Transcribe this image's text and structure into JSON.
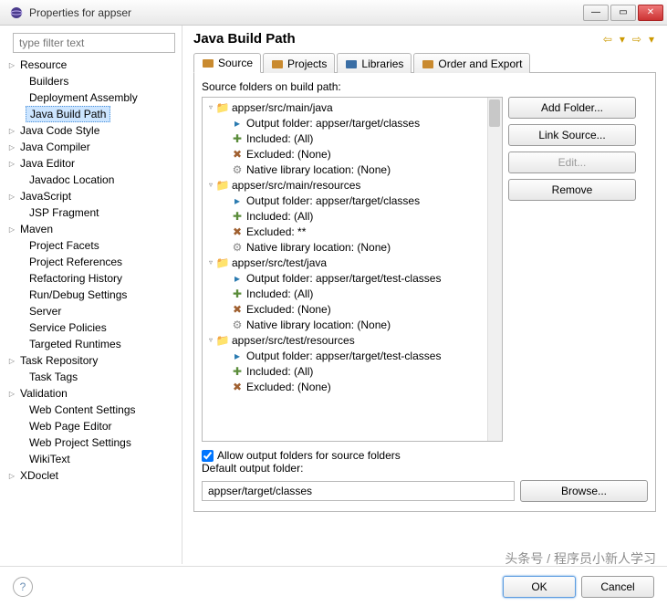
{
  "window": {
    "title": "Properties for appser"
  },
  "sidebar": {
    "filter_placeholder": "type filter text",
    "items": [
      {
        "label": "Resource",
        "expand": true,
        "indent": false
      },
      {
        "label": "Builders",
        "expand": false,
        "indent": true
      },
      {
        "label": "Deployment Assembly",
        "expand": false,
        "indent": true
      },
      {
        "label": "Java Build Path",
        "expand": false,
        "indent": true,
        "selected": true
      },
      {
        "label": "Java Code Style",
        "expand": true,
        "indent": false
      },
      {
        "label": "Java Compiler",
        "expand": true,
        "indent": false
      },
      {
        "label": "Java Editor",
        "expand": true,
        "indent": false
      },
      {
        "label": "Javadoc Location",
        "expand": false,
        "indent": true
      },
      {
        "label": "JavaScript",
        "expand": true,
        "indent": false
      },
      {
        "label": "JSP Fragment",
        "expand": false,
        "indent": true
      },
      {
        "label": "Maven",
        "expand": true,
        "indent": false
      },
      {
        "label": "Project Facets",
        "expand": false,
        "indent": true
      },
      {
        "label": "Project References",
        "expand": false,
        "indent": true
      },
      {
        "label": "Refactoring History",
        "expand": false,
        "indent": true
      },
      {
        "label": "Run/Debug Settings",
        "expand": false,
        "indent": true
      },
      {
        "label": "Server",
        "expand": false,
        "indent": true
      },
      {
        "label": "Service Policies",
        "expand": false,
        "indent": true
      },
      {
        "label": "Targeted Runtimes",
        "expand": false,
        "indent": true
      },
      {
        "label": "Task Repository",
        "expand": true,
        "indent": false
      },
      {
        "label": "Task Tags",
        "expand": false,
        "indent": true
      },
      {
        "label": "Validation",
        "expand": true,
        "indent": false
      },
      {
        "label": "Web Content Settings",
        "expand": false,
        "indent": true
      },
      {
        "label": "Web Page Editor",
        "expand": false,
        "indent": true
      },
      {
        "label": "Web Project Settings",
        "expand": false,
        "indent": true
      },
      {
        "label": "WikiText",
        "expand": false,
        "indent": true
      },
      {
        "label": "XDoclet",
        "expand": true,
        "indent": false
      }
    ]
  },
  "header": {
    "title": "Java Build Path"
  },
  "tabs": [
    {
      "label": "Source",
      "active": true
    },
    {
      "label": "Projects",
      "active": false
    },
    {
      "label": "Libraries",
      "active": false
    },
    {
      "label": "Order and Export",
      "active": false
    }
  ],
  "source": {
    "label": "Source folders on build path:",
    "tree": [
      {
        "indent": 0,
        "twist": "▿",
        "ico": "folder",
        "text": "appser/src/main/java"
      },
      {
        "indent": 1,
        "twist": "",
        "ico": "out",
        "text": "Output folder: appser/target/classes"
      },
      {
        "indent": 1,
        "twist": "",
        "ico": "inc",
        "text": "Included: (All)"
      },
      {
        "indent": 1,
        "twist": "",
        "ico": "exc",
        "text": "Excluded: (None)"
      },
      {
        "indent": 1,
        "twist": "",
        "ico": "nat",
        "text": "Native library location: (None)"
      },
      {
        "indent": 0,
        "twist": "▿",
        "ico": "folder",
        "text": "appser/src/main/resources"
      },
      {
        "indent": 1,
        "twist": "",
        "ico": "out",
        "text": "Output folder: appser/target/classes"
      },
      {
        "indent": 1,
        "twist": "",
        "ico": "inc",
        "text": "Included: (All)"
      },
      {
        "indent": 1,
        "twist": "",
        "ico": "exc",
        "text": "Excluded: **"
      },
      {
        "indent": 1,
        "twist": "",
        "ico": "nat",
        "text": "Native library location: (None)"
      },
      {
        "indent": 0,
        "twist": "▿",
        "ico": "folder",
        "text": "appser/src/test/java"
      },
      {
        "indent": 1,
        "twist": "",
        "ico": "out",
        "text": "Output folder: appser/target/test-classes"
      },
      {
        "indent": 1,
        "twist": "",
        "ico": "inc",
        "text": "Included: (All)"
      },
      {
        "indent": 1,
        "twist": "",
        "ico": "exc",
        "text": "Excluded: (None)"
      },
      {
        "indent": 1,
        "twist": "",
        "ico": "nat",
        "text": "Native library location: (None)"
      },
      {
        "indent": 0,
        "twist": "▿",
        "ico": "folder",
        "text": "appser/src/test/resources"
      },
      {
        "indent": 1,
        "twist": "",
        "ico": "out",
        "text": "Output folder: appser/target/test-classes"
      },
      {
        "indent": 1,
        "twist": "",
        "ico": "inc",
        "text": "Included: (All)"
      },
      {
        "indent": 1,
        "twist": "",
        "ico": "exc",
        "text": "Excluded: (None)"
      }
    ],
    "buttons": {
      "add_folder": "Add Folder...",
      "link_source": "Link Source...",
      "edit": "Edit...",
      "remove": "Remove"
    },
    "allow_checkbox": "Allow output folders for source folders",
    "default_label": "Default output folder:",
    "default_value": "appser/target/classes",
    "browse": "Browse..."
  },
  "footer": {
    "ok": "OK",
    "cancel": "Cancel"
  },
  "watermark": "头条号 / 程序员小新人学习"
}
